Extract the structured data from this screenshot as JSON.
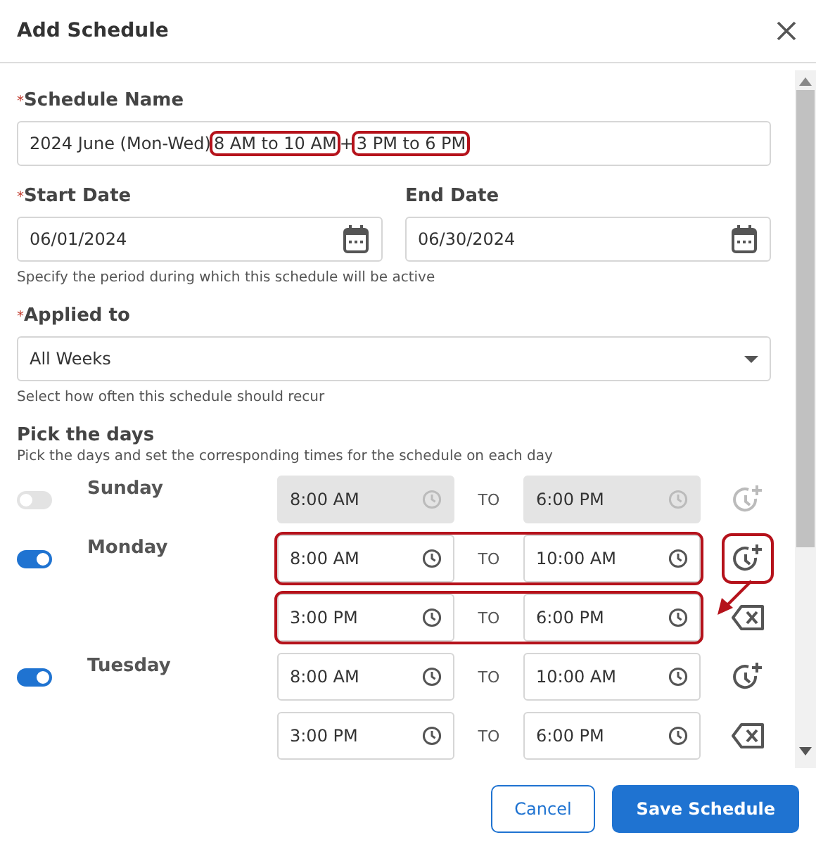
{
  "dialog": {
    "title": "Add Schedule"
  },
  "schedule_name": {
    "label": "Schedule Name",
    "required_mark": "*",
    "value_parts": [
      {
        "text": "2024 June (Mon-Wed)",
        "highlighted": false
      },
      {
        "text": "8 AM to 10 AM",
        "highlighted": true
      },
      {
        "text": "+",
        "highlighted": false
      },
      {
        "text": "3 PM to 6 PM",
        "highlighted": true
      }
    ]
  },
  "start_date": {
    "label": "Start Date",
    "required_mark": "*",
    "value": "06/01/2024"
  },
  "end_date": {
    "label": "End Date",
    "value": "06/30/2024"
  },
  "date_help": "Specify the period during which this schedule will be active",
  "applied_to": {
    "label": "Applied to",
    "required_mark": "*",
    "value": "All Weeks",
    "help": "Select how often this schedule should recur"
  },
  "days_section": {
    "title": "Pick the days",
    "subtitle": "Pick the days and set the corresponding times for the schedule on each day"
  },
  "days": [
    {
      "name": "Sunday",
      "on": false,
      "add_highlighted": false,
      "arrow": false,
      "slots": [
        {
          "start": "8:00 AM",
          "separator": "TO",
          "end": "6:00 PM",
          "highlighted": false
        }
      ]
    },
    {
      "name": "Monday",
      "on": true,
      "add_highlighted": true,
      "arrow": true,
      "slots": [
        {
          "start": "8:00 AM",
          "separator": "TO",
          "end": "10:00 AM",
          "highlighted": true
        },
        {
          "start": "3:00 PM",
          "separator": "TO",
          "end": "6:00 PM",
          "highlighted": true
        }
      ]
    },
    {
      "name": "Tuesday",
      "on": true,
      "add_highlighted": false,
      "arrow": false,
      "slots": [
        {
          "start": "8:00 AM",
          "separator": "TO",
          "end": "10:00 AM",
          "highlighted": false
        },
        {
          "start": "3:00 PM",
          "separator": "TO",
          "end": "6:00 PM",
          "highlighted": false
        }
      ]
    }
  ],
  "buttons": [
    {
      "label": "Cancel",
      "kind": "secondary"
    },
    {
      "label": "Save Schedule",
      "kind": "primary"
    }
  ]
}
